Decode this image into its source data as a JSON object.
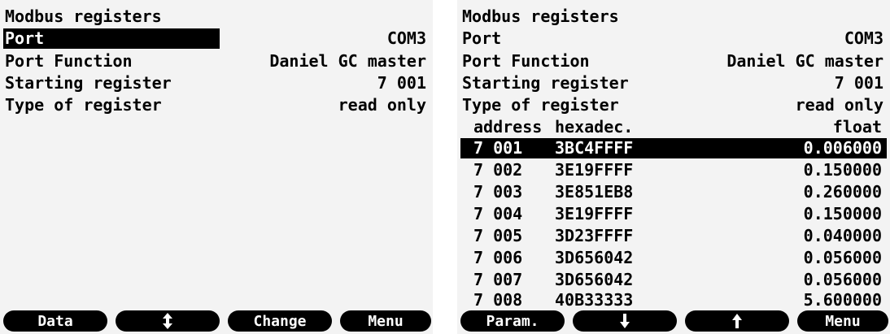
{
  "left": {
    "title": "Modbus registers",
    "fields": [
      {
        "label": "Port",
        "value": "COM3"
      },
      {
        "label": "Port Function",
        "value": "Daniel GC master"
      },
      {
        "label": "Starting register",
        "value": "7 001"
      },
      {
        "label": "Type of register",
        "value": "read only"
      }
    ],
    "softkeys": [
      {
        "label": "Data",
        "icon": null
      },
      {
        "label": "",
        "icon": "up-down-arrow-icon"
      },
      {
        "label": "Change",
        "icon": null
      },
      {
        "label": "Menu",
        "icon": null
      }
    ]
  },
  "right": {
    "title": "Modbus registers",
    "fields": [
      {
        "label": "Port",
        "value": "COM3"
      },
      {
        "label": "Port Function",
        "value": "Daniel GC master"
      },
      {
        "label": "Starting register",
        "value": "7 001"
      },
      {
        "label": "Type of register",
        "value": "read only"
      }
    ],
    "table": {
      "headers": {
        "address": "address",
        "hex": "hexadec.",
        "float": "float"
      },
      "rows": [
        {
          "address": "7 001",
          "hex": "3BC4FFFF",
          "float": "0.006000"
        },
        {
          "address": "7 002",
          "hex": "3E19FFFF",
          "float": "0.150000"
        },
        {
          "address": "7 003",
          "hex": "3E851EB8",
          "float": "0.260000"
        },
        {
          "address": "7 004",
          "hex": "3E19FFFF",
          "float": "0.150000"
        },
        {
          "address": "7 005",
          "hex": "3D23FFFF",
          "float": "0.040000"
        },
        {
          "address": "7 006",
          "hex": "3D656042",
          "float": "0.056000"
        },
        {
          "address": "7 007",
          "hex": "3D656042",
          "float": "0.056000"
        },
        {
          "address": "7 008",
          "hex": "40B33333",
          "float": "5.600000"
        }
      ]
    },
    "softkeys": [
      {
        "label": "Param.",
        "icon": null
      },
      {
        "label": "",
        "icon": "down-arrow-icon"
      },
      {
        "label": "",
        "icon": "up-arrow-icon"
      },
      {
        "label": "Menu",
        "icon": null
      }
    ]
  },
  "colors": {
    "screen_background": "#f3f3f3",
    "highlight": "#000000",
    "text": "#000000"
  }
}
